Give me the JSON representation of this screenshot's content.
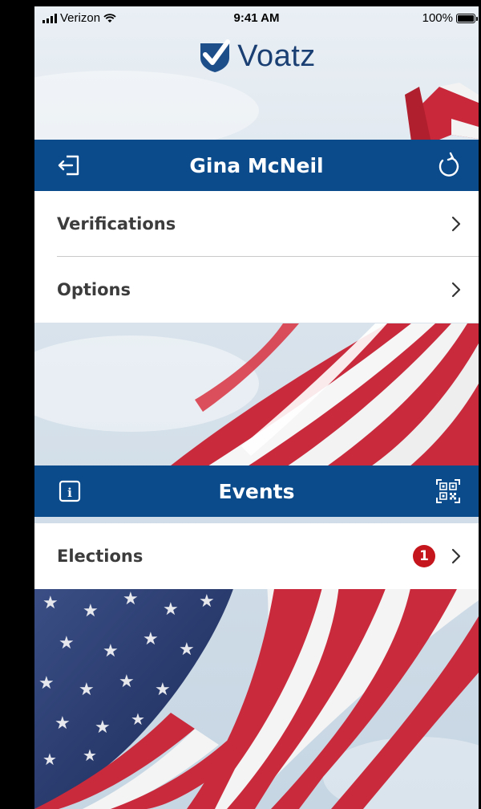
{
  "status_bar": {
    "carrier": "Verizon",
    "time": "9:41 AM",
    "battery": "100%",
    "battery_level": 1.0
  },
  "app": {
    "logo_text": "Voatz",
    "brand_color": "#1a3f73",
    "bar_color": "#0b4b8c",
    "badge_color": "#c4161c"
  },
  "profile_bar": {
    "title": "Gina McNeil",
    "left_icon": "logout-icon",
    "right_icon": "refresh-icon"
  },
  "profile_menu": {
    "items": [
      {
        "label": "Verifications"
      },
      {
        "label": "Options"
      }
    ]
  },
  "events_bar": {
    "title": "Events",
    "left_icon": "info-icon",
    "right_icon": "qr-code-icon"
  },
  "events_menu": {
    "items": [
      {
        "label": "Elections",
        "badge": "1"
      }
    ]
  }
}
